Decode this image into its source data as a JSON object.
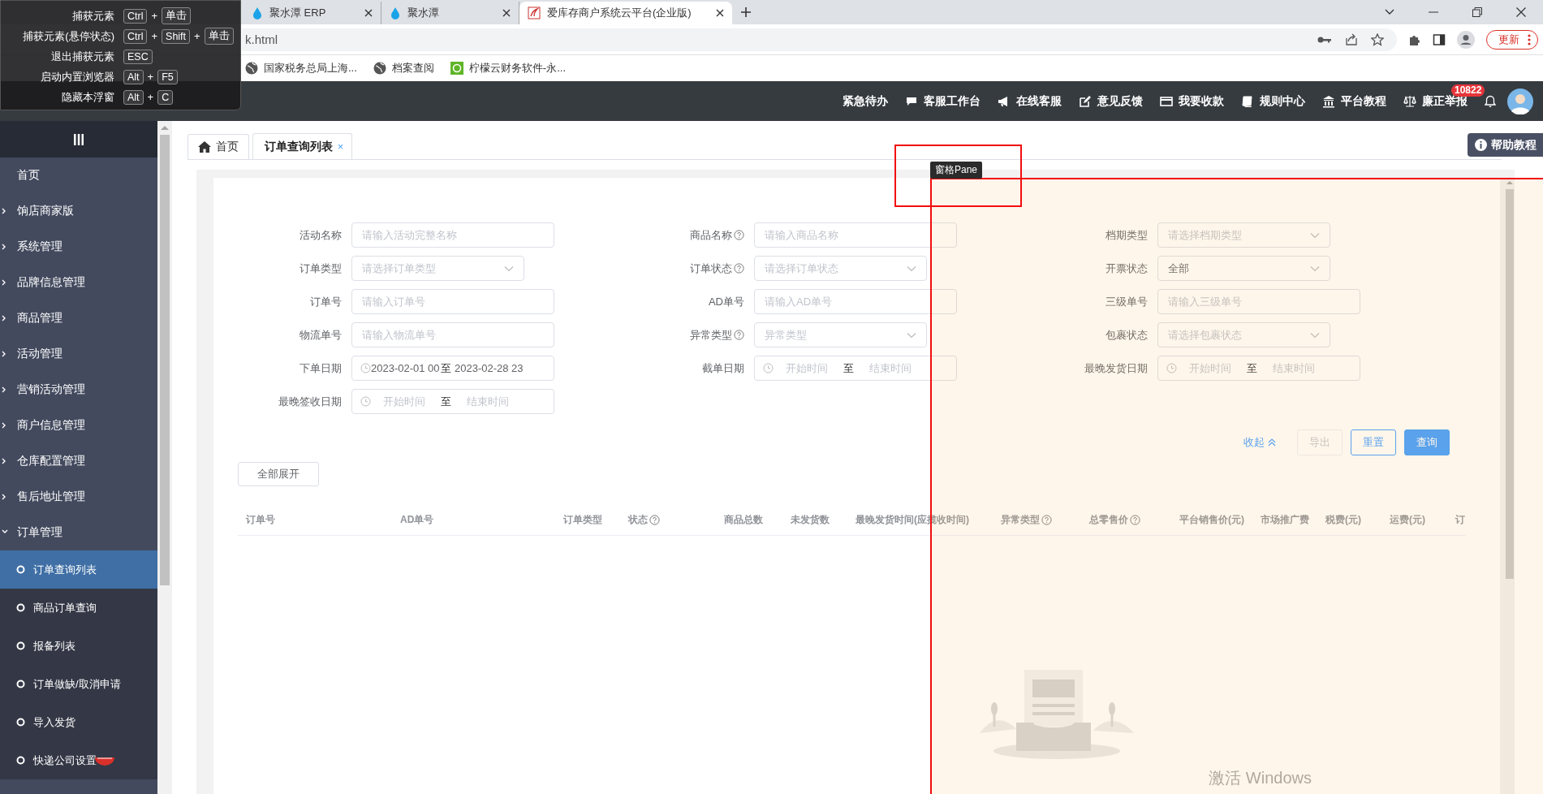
{
  "shortcut_panel": {
    "rows": [
      {
        "label": "捕获元素",
        "parts": [
          "Ctrl",
          "+",
          "单击"
        ]
      },
      {
        "label": "捕获元素(悬停状态)",
        "parts": [
          "Ctrl",
          "+",
          "Shift",
          "+",
          "单击"
        ]
      },
      {
        "label": "退出捕获元素",
        "parts": [
          "ESC"
        ]
      },
      {
        "label": "启动内置浏览器",
        "parts": [
          "Alt",
          "+",
          "F5"
        ]
      },
      {
        "label": "隐藏本浮窗",
        "parts": [
          "Alt",
          "+",
          "C"
        ]
      }
    ]
  },
  "browser": {
    "tabs": [
      {
        "title": "聚水潭 ERP",
        "selected": false
      },
      {
        "title": "聚水潭",
        "selected": false
      },
      {
        "title": "爱库存商户系统云平台(企业版)",
        "selected": true
      }
    ],
    "url": "k.html",
    "update_button": "更新",
    "bookmarks": [
      "国家税务总局上海...",
      "档案查阅",
      "柠檬云财务软件-永..."
    ]
  },
  "header": {
    "nav": [
      "紧急待办",
      "客服工作台",
      "在线客服",
      "意见反馈",
      "我要收款",
      "规则中心",
      "平台教程",
      "廉正举报"
    ],
    "badge": "10822"
  },
  "sidebar": {
    "items": [
      {
        "label": "首页",
        "kind": "link"
      },
      {
        "label": "饷店商家版",
        "kind": "group",
        "expanded": false
      },
      {
        "label": "系统管理",
        "kind": "group",
        "expanded": false
      },
      {
        "label": "品牌信息管理",
        "kind": "group",
        "expanded": false
      },
      {
        "label": "商品管理",
        "kind": "group",
        "expanded": false
      },
      {
        "label": "活动管理",
        "kind": "group",
        "expanded": false
      },
      {
        "label": "营销活动管理",
        "kind": "group",
        "expanded": false
      },
      {
        "label": "商户信息管理",
        "kind": "group",
        "expanded": false
      },
      {
        "label": "仓库配置管理",
        "kind": "group",
        "expanded": false
      },
      {
        "label": "售后地址管理",
        "kind": "group",
        "expanded": false
      },
      {
        "label": "订单管理",
        "kind": "group",
        "expanded": true,
        "children": [
          {
            "label": "订单查询列表",
            "selected": true
          },
          {
            "label": "商品订单查询",
            "selected": false
          },
          {
            "label": "报备列表",
            "selected": false
          },
          {
            "label": "订单做缺/取消申请",
            "selected": false
          },
          {
            "label": "导入发货",
            "selected": false
          },
          {
            "label": "快递公司设置",
            "selected": false
          }
        ]
      }
    ]
  },
  "page_tabs": [
    {
      "label": "首页",
      "selected": false,
      "closable": false
    },
    {
      "label": "订单查询列表",
      "selected": true,
      "closable": true,
      "close": "×"
    }
  ],
  "help_button": "帮助教程",
  "form": {
    "fields": [
      {
        "label": "活动名称",
        "kind": "text",
        "help": false,
        "placeholder": "请输入活动完整名称"
      },
      {
        "label": "商品名称",
        "kind": "text",
        "help": true,
        "placeholder": "请输入商品名称"
      },
      {
        "label": "档期类型",
        "kind": "select",
        "help": false,
        "placeholder": "请选择档期类型"
      },
      {
        "label": "订单类型",
        "kind": "select",
        "help": false,
        "placeholder": "请选择订单类型"
      },
      {
        "label": "订单状态",
        "kind": "select",
        "help": true,
        "placeholder": "请选择订单状态"
      },
      {
        "label": "开票状态",
        "kind": "select",
        "help": false,
        "value": "全部"
      },
      {
        "label": "订单号",
        "kind": "text",
        "help": false,
        "placeholder": "请输入订单号"
      },
      {
        "label": "AD单号",
        "kind": "text",
        "help": false,
        "placeholder": "请输入AD单号"
      },
      {
        "label": "三级单号",
        "kind": "text",
        "help": false,
        "placeholder": "请输入三级单号"
      },
      {
        "label": "物流单号",
        "kind": "text",
        "help": false,
        "placeholder": "请输入物流单号"
      },
      {
        "label": "异常类型",
        "kind": "select",
        "help": true,
        "placeholder": "异常类型"
      },
      {
        "label": "包裹状态",
        "kind": "select",
        "help": false,
        "placeholder": "请选择包裹状态"
      },
      {
        "label": "下单日期",
        "kind": "daterange",
        "help": false,
        "filled": true,
        "start": "2023-02-01 00",
        "separator": "至",
        "end": "2023-02-28 23"
      },
      {
        "label": "截单日期",
        "kind": "daterange",
        "help": false,
        "filled": false,
        "start": "开始时间",
        "separator": "至",
        "end": "结束时间"
      },
      {
        "label": "最晚发货日期",
        "kind": "daterange",
        "help": false,
        "filled": false,
        "start": "开始时间",
        "separator": "至",
        "end": "结束时间"
      },
      {
        "label": "最晚签收日期",
        "kind": "daterange",
        "help": false,
        "filled": false,
        "start": "开始时间",
        "separator": "至",
        "end": "结束时间"
      }
    ]
  },
  "actions": {
    "collapse": "收起",
    "buttons": [
      {
        "label": "导出",
        "kind": "plain",
        "disabled": true
      },
      {
        "label": "重置",
        "kind": "outline",
        "disabled": false
      },
      {
        "label": "查询",
        "kind": "primary",
        "disabled": false
      }
    ]
  },
  "expand_all": "全部展开",
  "table": {
    "columns": [
      {
        "label": "订单号",
        "help": false
      },
      {
        "label": "AD单号",
        "help": false
      },
      {
        "label": "订单类型",
        "help": false
      },
      {
        "label": "状态",
        "help": true
      },
      {
        "label": "商品总数",
        "help": false
      },
      {
        "label": "未发货数",
        "help": false
      },
      {
        "label": "最晚发货时间(应揽收时间)",
        "help": false
      },
      {
        "label": "异常类型",
        "help": true
      },
      {
        "label": "总零售价",
        "help": true
      },
      {
        "label": "平台销售价(元)",
        "help": false
      },
      {
        "label": "市场推广费",
        "help": false
      },
      {
        "label": "税费(元)",
        "help": false
      },
      {
        "label": "运费(元)",
        "help": false
      },
      {
        "label": "订",
        "help": false
      }
    ]
  },
  "inspector": {
    "label": "窗格Pane"
  },
  "os_notice": "激活 Windows"
}
